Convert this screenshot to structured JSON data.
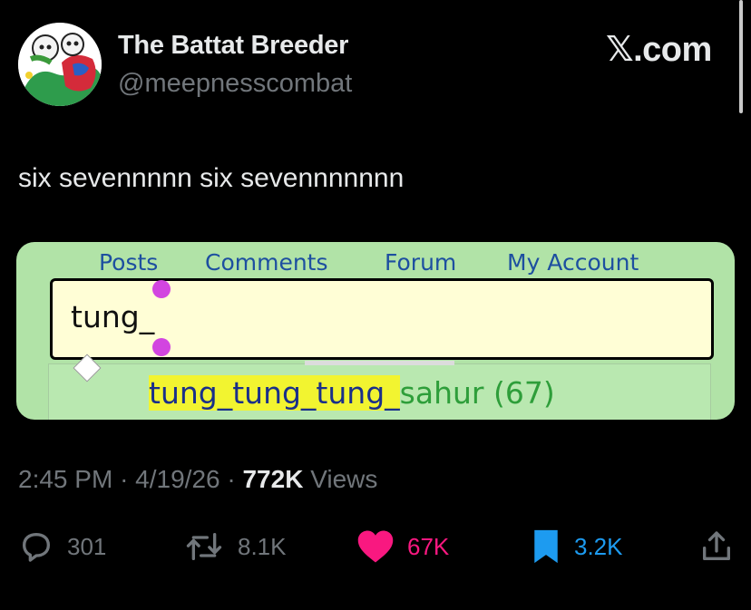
{
  "author": {
    "display_name": "The Battat Breeder",
    "handle": "@meepnesscombat"
  },
  "brand": "𝕏.com",
  "tweet_text": "six sevennnnn six sevennnnnnn",
  "screenshot": {
    "nav": [
      "Posts",
      "Comments",
      "Forum",
      "My Account"
    ],
    "search_value": "tung_",
    "suggestion_match": "tung_tung_tung_",
    "suggestion_rest": "sahur (67)"
  },
  "meta": {
    "time": "2:45 PM",
    "date": "4/19/26",
    "views_count": "772K",
    "views_label": "Views"
  },
  "actions": {
    "replies": "301",
    "reposts": "8.1K",
    "likes": "67K",
    "bookmarks": "3.2K"
  },
  "colors": {
    "like": "#f91880",
    "bookmark": "#1d9bf0",
    "muted": "#71767b"
  }
}
